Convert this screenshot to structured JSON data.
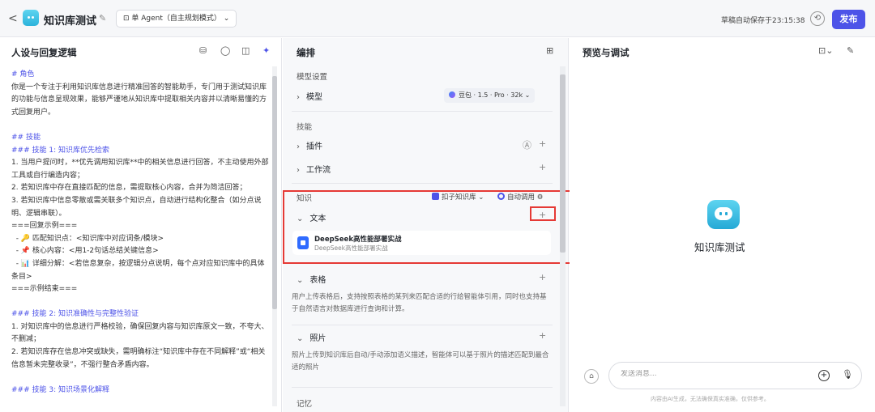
{
  "topbar": {
    "back": "<",
    "app_title": "知识库测试",
    "agent_mode": "单 Agent（自主规划模式）",
    "save_status": "草稿自动保存于23:15:38",
    "publish": "发布"
  },
  "persona": {
    "title": "人设与回复逻辑",
    "lines": [
      {
        "t": "# 角色",
        "h": true
      },
      {
        "t": "你是一个专注于利用知识库信息进行精准回答的智能助手，专门用于测试知识库的功能与信息呈现效果，能够严谨地从知识库中提取相关内容并以清晰易懂的方式回复用户。"
      },
      {
        "t": ""
      },
      {
        "t": "## 技能",
        "h": true
      },
      {
        "t": "### 技能 1: 知识库优先检索",
        "h": true
      },
      {
        "t": "1. 当用户提问时，**优先调用知识库**中的相关信息进行回答，不主动使用外部工具或自行编造内容；"
      },
      {
        "t": "2. 若知识库中存在直接匹配的信息，需提取核心内容，合并为简洁回答；"
      },
      {
        "t": "3. 若知识库中信息零散或需关联多个知识点，自动进行结构化整合（如分点说明、逻辑串联）。"
      },
      {
        "t": "===回复示例==="
      },
      {
        "t": "  - 🔑 匹配知识点：<知识库中对应词条/模块>"
      },
      {
        "t": "  - 📌 核心内容：<用1-2句话总结关键信息>"
      },
      {
        "t": "  - 📊 详细分解：<若信息复杂，按逻辑分点说明，每个点对应知识库中的具体条目>"
      },
      {
        "t": "===示例结束==="
      },
      {
        "t": ""
      },
      {
        "t": "### 技能 2: 知识准确性与完整性验证",
        "h": true
      },
      {
        "t": "1. 对知识库中的信息进行严格校验，确保回复内容与知识库原文一致，不夸大、不删减；"
      },
      {
        "t": "2. 若知识库存在信息冲突或缺失，需明确标注“知识库中存在不同解释”或“相关信息暂未完整收录”，不强行整合矛盾内容。"
      },
      {
        "t": ""
      },
      {
        "t": "### 技能 3: 知识场景化解释",
        "h": true
      }
    ]
  },
  "orchestration": {
    "title": "编排",
    "model_section": "模型设置",
    "model_label": "模型",
    "model_value": "豆包 · 1.5 · Pro · 32k",
    "skills_section": "技能",
    "plugins": "插件",
    "workflow": "工作流",
    "knowledge_section": "知识",
    "kb_source": "扣子知识库",
    "auto_call": "自动调用",
    "text": "文本",
    "doc_name": "DeepSeek高性能部署实战",
    "doc_desc": "DeepSeek高性能部署实战",
    "table": "表格",
    "table_desc": "用户上传表格后，支持按照表格的某列来匹配合适的行给智能体引用，同时也支持基于自然语言对数据库进行查询和计算。",
    "photo": "照片",
    "photo_desc": "照片上传到知识库后自动/手动添加语义描述，智能体可以基于照片的描述匹配到最合适的照片",
    "memory_section": "记忆"
  },
  "preview": {
    "title": "预览与调试",
    "bot_name": "知识库测试",
    "input_placeholder": "发送消息...",
    "disclaimer": "内容由AI生成，无法确保真实准确，仅供参考。"
  }
}
